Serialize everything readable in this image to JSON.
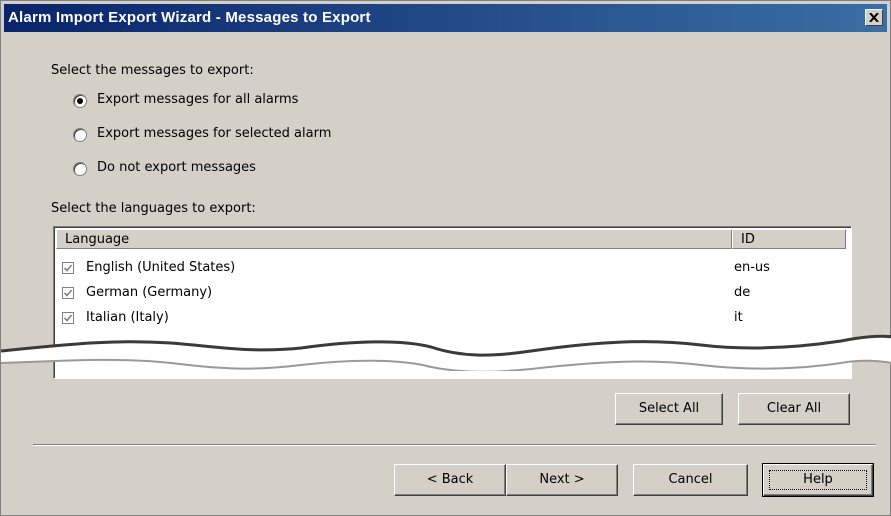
{
  "window": {
    "title": "Alarm Import Export Wizard - Messages to Export"
  },
  "messages": {
    "prompt": "Select the messages to export:",
    "options": [
      {
        "label": "Export messages for all alarms",
        "selected": true
      },
      {
        "label": "Export messages for selected alarm",
        "selected": false
      },
      {
        "label": "Do not export messages",
        "selected": false
      }
    ]
  },
  "languages": {
    "prompt": "Select the languages to export:",
    "columns": {
      "language": "Language",
      "id": "ID"
    },
    "rows": [
      {
        "language": "English (United States)",
        "id": "en-us",
        "checked": true
      },
      {
        "language": "German (Germany)",
        "id": "de",
        "checked": true
      },
      {
        "language": "Italian (Italy)",
        "id": "it",
        "checked": true
      }
    ],
    "select_all": "Select All",
    "clear_all": "Clear All"
  },
  "footer": {
    "back": "< Back",
    "next": "Next >",
    "cancel": "Cancel",
    "help": "Help"
  },
  "icons": {
    "close": "close-icon",
    "checkbox": "checkmark-icon"
  }
}
